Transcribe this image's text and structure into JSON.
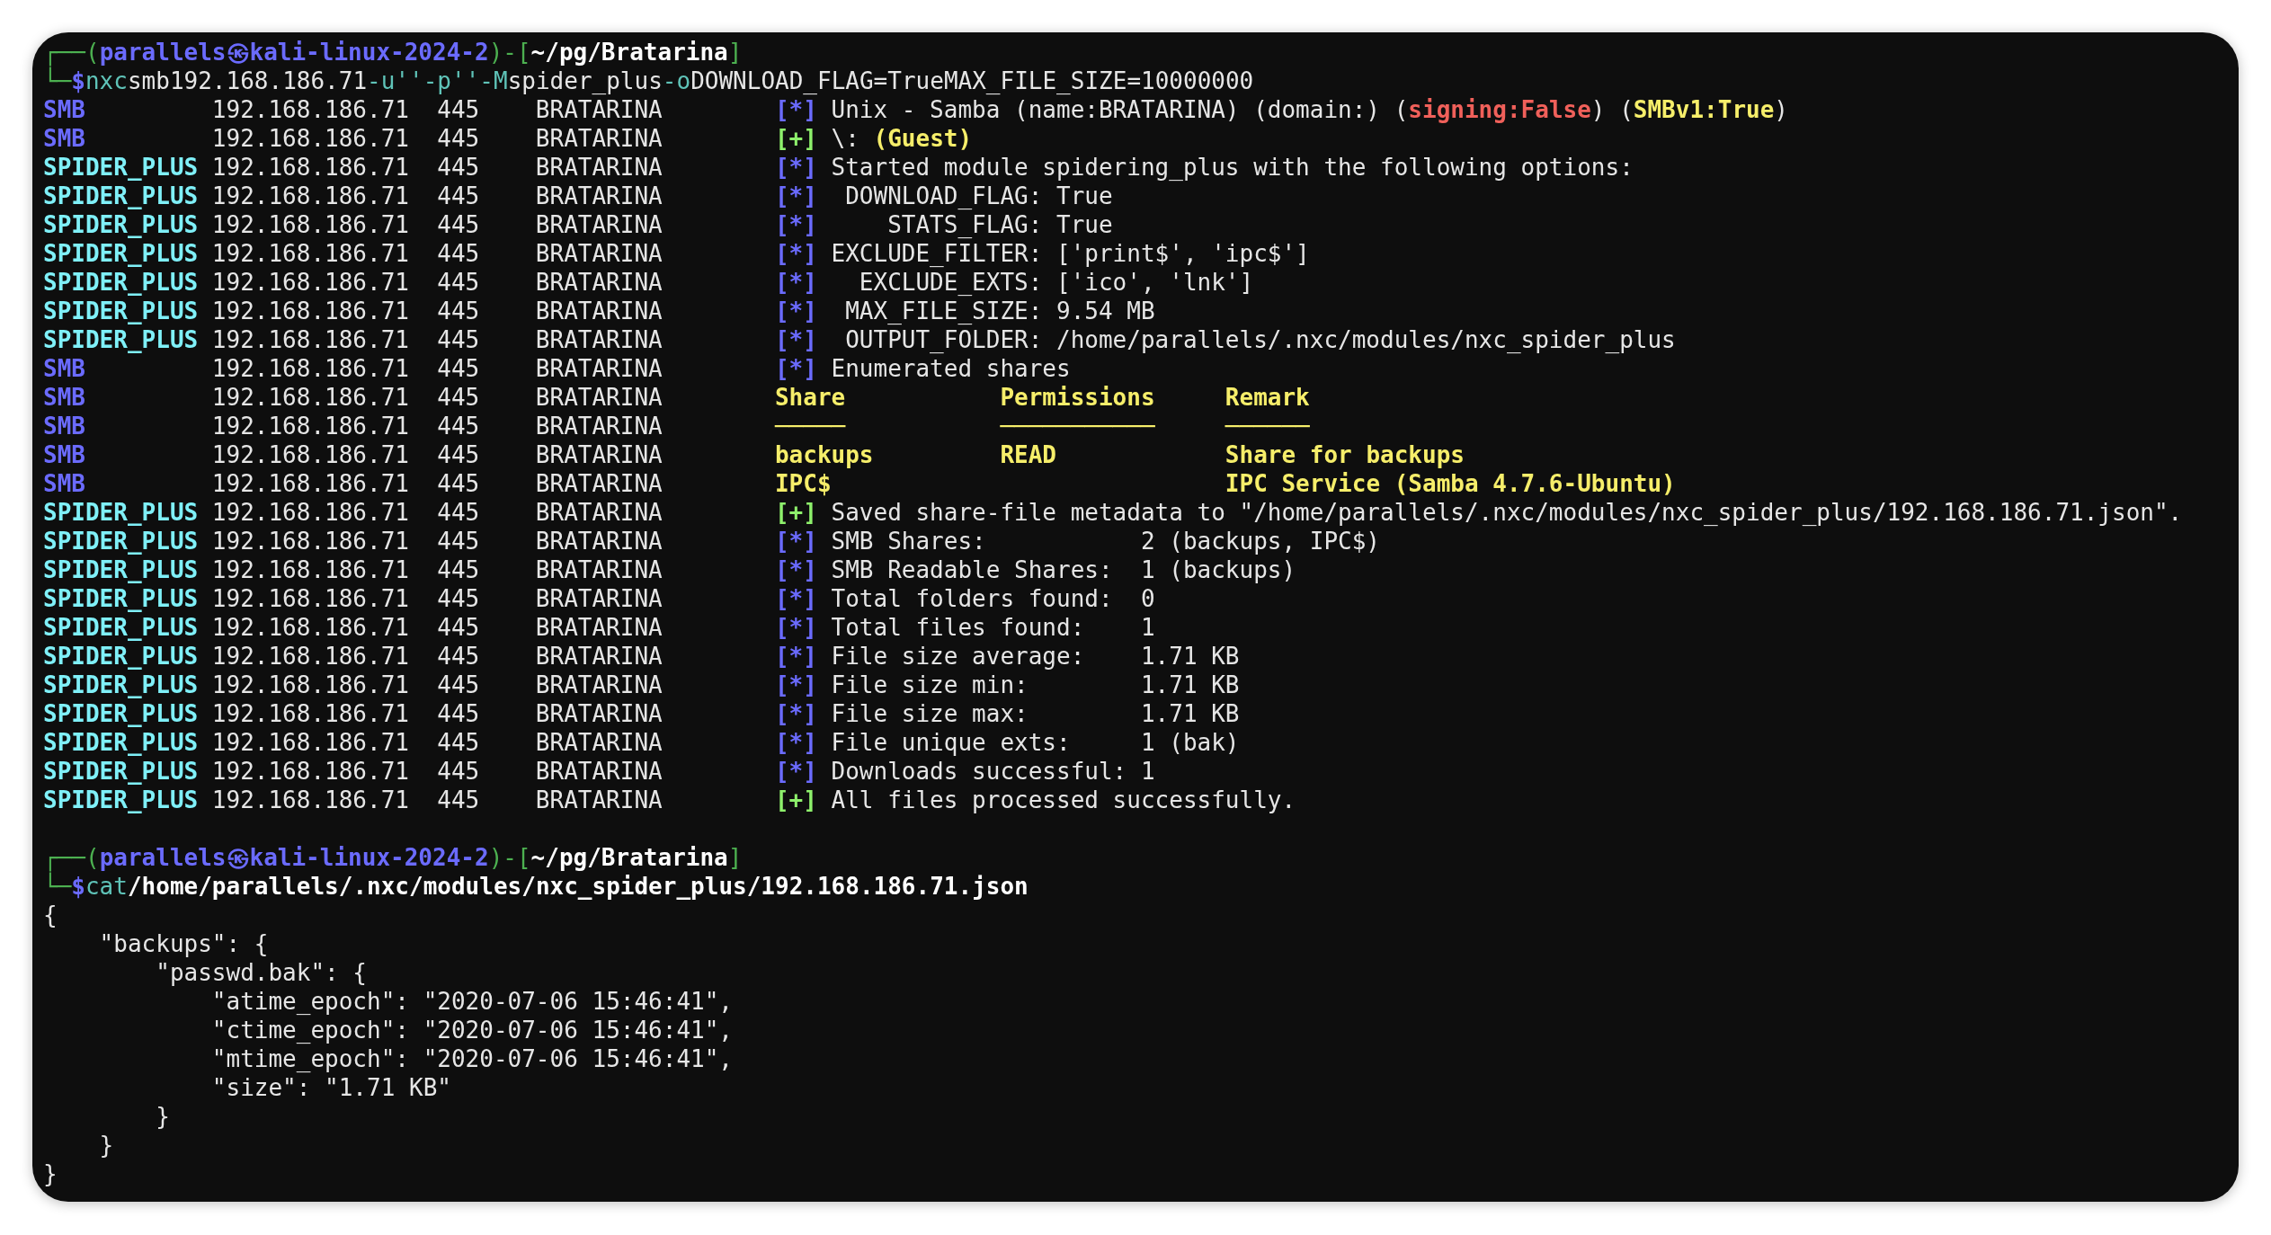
{
  "terminal": {
    "lines": [
      {
        "kind": "prompt",
        "corner": "┌──(",
        "user_host": "parallels㉿kali-linux-2024-2",
        "mid": ")-[",
        "path": "~/pg/Bratarina",
        "end": "]"
      },
      {
        "kind": "command",
        "lead": "└─",
        "symbol": "$",
        "parts": [
          {
            "kind": "program",
            "text": "nxc"
          },
          {
            "kind": "arg",
            "text": "smb"
          },
          {
            "kind": "arg",
            "text": "192.168.186.71"
          },
          {
            "kind": "flag",
            "text": "-u"
          },
          {
            "kind": "flag",
            "text": "''"
          },
          {
            "kind": "flag",
            "text": "-p"
          },
          {
            "kind": "flag",
            "text": "''"
          },
          {
            "kind": "flag",
            "text": "-M"
          },
          {
            "kind": "arg",
            "text": "spider_plus"
          },
          {
            "kind": "flag",
            "text": "-o"
          },
          {
            "kind": "arg",
            "text": "DOWNLOAD_FLAG=True"
          },
          {
            "kind": "arg",
            "text": "MAX_FILE_SIZE=10000000"
          }
        ]
      },
      {
        "kind": "log",
        "module": "SMB",
        "color": "#6b6bff",
        "ip": "192.168.186.71",
        "port": "445",
        "host": "BRATARINA",
        "marker": {
          "text": "[*]",
          "color": "#6b6bff"
        },
        "message": [
          {
            "kind": "plain",
            "text": "Unix - Samba (name:BRATARINA) (domain:) ("
          },
          {
            "kind": "bad",
            "text": "signing:False"
          },
          {
            "kind": "plain",
            "text": ") ("
          },
          {
            "kind": "warn",
            "text": "SMBv1:True"
          },
          {
            "kind": "plain",
            "text": ")"
          }
        ]
      },
      {
        "kind": "log",
        "module": "SMB",
        "color": "#6b6bff",
        "ip": "192.168.186.71",
        "port": "445",
        "host": "BRATARINA",
        "marker": {
          "text": "[+]",
          "color": "#8ef06c"
        },
        "message": [
          {
            "kind": "plain",
            "text": "\\: "
          },
          {
            "kind": "warn",
            "text": "(Guest)"
          }
        ]
      },
      {
        "kind": "log",
        "module": "SPIDER_PLUS",
        "color": "#7ff0f8",
        "ip": "192.168.186.71",
        "port": "445",
        "host": "BRATARINA",
        "marker": {
          "text": "[*]",
          "color": "#6b6bff"
        },
        "message": [
          {
            "kind": "plain",
            "text": "Started module spidering_plus with the following options:"
          }
        ]
      },
      {
        "kind": "log",
        "module": "SPIDER_PLUS",
        "color": "#7ff0f8",
        "ip": "192.168.186.71",
        "port": "445",
        "host": "BRATARINA",
        "marker": {
          "text": "[*]",
          "color": "#6b6bff"
        },
        "message": [
          {
            "kind": "plain",
            "text": " DOWNLOAD_FLAG: True"
          }
        ]
      },
      {
        "kind": "log",
        "module": "SPIDER_PLUS",
        "color": "#7ff0f8",
        "ip": "192.168.186.71",
        "port": "445",
        "host": "BRATARINA",
        "marker": {
          "text": "[*]",
          "color": "#6b6bff"
        },
        "message": [
          {
            "kind": "plain",
            "text": "    STATS_FLAG: True"
          }
        ]
      },
      {
        "kind": "log",
        "module": "SPIDER_PLUS",
        "color": "#7ff0f8",
        "ip": "192.168.186.71",
        "port": "445",
        "host": "BRATARINA",
        "marker": {
          "text": "[*]",
          "color": "#6b6bff"
        },
        "message": [
          {
            "kind": "plain",
            "text": "EXCLUDE_FILTER: ['print$', 'ipc$']"
          }
        ]
      },
      {
        "kind": "log",
        "module": "SPIDER_PLUS",
        "color": "#7ff0f8",
        "ip": "192.168.186.71",
        "port": "445",
        "host": "BRATARINA",
        "marker": {
          "text": "[*]",
          "color": "#6b6bff"
        },
        "message": [
          {
            "kind": "plain",
            "text": "  EXCLUDE_EXTS: ['ico', 'lnk']"
          }
        ]
      },
      {
        "kind": "log",
        "module": "SPIDER_PLUS",
        "color": "#7ff0f8",
        "ip": "192.168.186.71",
        "port": "445",
        "host": "BRATARINA",
        "marker": {
          "text": "[*]",
          "color": "#6b6bff"
        },
        "message": [
          {
            "kind": "plain",
            "text": " MAX_FILE_SIZE: 9.54 MB"
          }
        ]
      },
      {
        "kind": "log",
        "module": "SPIDER_PLUS",
        "color": "#7ff0f8",
        "ip": "192.168.186.71",
        "port": "445",
        "host": "BRATARINA",
        "marker": {
          "text": "[*]",
          "color": "#6b6bff"
        },
        "message": [
          {
            "kind": "plain",
            "text": " OUTPUT_FOLDER: /home/parallels/.nxc/modules/nxc_spider_plus"
          }
        ]
      },
      {
        "kind": "log",
        "module": "SMB",
        "color": "#6b6bff",
        "ip": "192.168.186.71",
        "port": "445",
        "host": "BRATARINA",
        "marker": {
          "text": "[*]",
          "color": "#6b6bff"
        },
        "message": [
          {
            "kind": "plain",
            "text": "Enumerated shares"
          }
        ]
      },
      {
        "kind": "table",
        "module": "SMB",
        "color": "#6b6bff",
        "ip": "192.168.186.71",
        "port": "445",
        "host": "BRATARINA",
        "share": "Share",
        "permissions": "Permissions",
        "remark": "Remark"
      },
      {
        "kind": "table",
        "module": "SMB",
        "color": "#6b6bff",
        "ip": "192.168.186.71",
        "port": "445",
        "host": "BRATARINA",
        "share": "─────",
        "permissions": "───────────",
        "remark": "──────"
      },
      {
        "kind": "table",
        "module": "SMB",
        "color": "#6b6bff",
        "ip": "192.168.186.71",
        "port": "445",
        "host": "BRATARINA",
        "share": "backups",
        "permissions": "READ",
        "remark": "Share for backups"
      },
      {
        "kind": "table",
        "module": "SMB",
        "color": "#6b6bff",
        "ip": "192.168.186.71",
        "port": "445",
        "host": "BRATARINA",
        "share": "IPC$",
        "remark": "IPC Service (Samba 4.7.6-Ubuntu)"
      },
      {
        "kind": "log",
        "module": "SPIDER_PLUS",
        "color": "#7ff0f8",
        "ip": "192.168.186.71",
        "port": "445",
        "host": "BRATARINA",
        "marker": {
          "text": "[+]",
          "color": "#8ef06c"
        },
        "message": [
          {
            "kind": "plain",
            "text": "Saved share-file metadata to \"/home/parallels/.nxc/modules/nxc_spider_plus/192.168.186.71.json\"."
          }
        ]
      },
      {
        "kind": "log",
        "module": "SPIDER_PLUS",
        "color": "#7ff0f8",
        "ip": "192.168.186.71",
        "port": "445",
        "host": "BRATARINA",
        "marker": {
          "text": "[*]",
          "color": "#6b6bff"
        },
        "message": [
          {
            "kind": "plain",
            "text": "SMB Shares:           2 (backups, IPC$)"
          }
        ]
      },
      {
        "kind": "log",
        "module": "SPIDER_PLUS",
        "color": "#7ff0f8",
        "ip": "192.168.186.71",
        "port": "445",
        "host": "BRATARINA",
        "marker": {
          "text": "[*]",
          "color": "#6b6bff"
        },
        "message": [
          {
            "kind": "plain",
            "text": "SMB Readable Shares:  1 (backups)"
          }
        ]
      },
      {
        "kind": "log",
        "module": "SPIDER_PLUS",
        "color": "#7ff0f8",
        "ip": "192.168.186.71",
        "port": "445",
        "host": "BRATARINA",
        "marker": {
          "text": "[*]",
          "color": "#6b6bff"
        },
        "message": [
          {
            "kind": "plain",
            "text": "Total folders found:  0"
          }
        ]
      },
      {
        "kind": "log",
        "module": "SPIDER_PLUS",
        "color": "#7ff0f8",
        "ip": "192.168.186.71",
        "port": "445",
        "host": "BRATARINA",
        "marker": {
          "text": "[*]",
          "color": "#6b6bff"
        },
        "message": [
          {
            "kind": "plain",
            "text": "Total files found:    1"
          }
        ]
      },
      {
        "kind": "log",
        "module": "SPIDER_PLUS",
        "color": "#7ff0f8",
        "ip": "192.168.186.71",
        "port": "445",
        "host": "BRATARINA",
        "marker": {
          "text": "[*]",
          "color": "#6b6bff"
        },
        "message": [
          {
            "kind": "plain",
            "text": "File size average:    1.71 KB"
          }
        ]
      },
      {
        "kind": "log",
        "module": "SPIDER_PLUS",
        "color": "#7ff0f8",
        "ip": "192.168.186.71",
        "port": "445",
        "host": "BRATARINA",
        "marker": {
          "text": "[*]",
          "color": "#6b6bff"
        },
        "message": [
          {
            "kind": "plain",
            "text": "File size min:        1.71 KB"
          }
        ]
      },
      {
        "kind": "log",
        "module": "SPIDER_PLUS",
        "color": "#7ff0f8",
        "ip": "192.168.186.71",
        "port": "445",
        "host": "BRATARINA",
        "marker": {
          "text": "[*]",
          "color": "#6b6bff"
        },
        "message": [
          {
            "kind": "plain",
            "text": "File size max:        1.71 KB"
          }
        ]
      },
      {
        "kind": "log",
        "module": "SPIDER_PLUS",
        "color": "#7ff0f8",
        "ip": "192.168.186.71",
        "port": "445",
        "host": "BRATARINA",
        "marker": {
          "text": "[*]",
          "color": "#6b6bff"
        },
        "message": [
          {
            "kind": "plain",
            "text": "File unique exts:     1 (bak)"
          }
        ]
      },
      {
        "kind": "log",
        "module": "SPIDER_PLUS",
        "color": "#7ff0f8",
        "ip": "192.168.186.71",
        "port": "445",
        "host": "BRATARINA",
        "marker": {
          "text": "[*]",
          "color": "#6b6bff"
        },
        "message": [
          {
            "kind": "plain",
            "text": "Downloads successful: 1"
          }
        ]
      },
      {
        "kind": "log",
        "module": "SPIDER_PLUS",
        "color": "#7ff0f8",
        "ip": "192.168.186.71",
        "port": "445",
        "host": "BRATARINA",
        "marker": {
          "text": "[+]",
          "color": "#8ef06c"
        },
        "message": [
          {
            "kind": "plain",
            "text": "All files processed successfully."
          }
        ]
      },
      {
        "kind": "blank"
      },
      {
        "kind": "prompt",
        "corner": "┌──(",
        "user_host": "parallels㉿kali-linux-2024-2",
        "mid": ")-[",
        "path": "~/pg/Bratarina",
        "end": "]"
      },
      {
        "kind": "command",
        "lead": "└─",
        "symbol": "$",
        "parts": [
          {
            "kind": "program",
            "text": "cat"
          },
          {
            "kind": "path",
            "text": "/home/parallels/.nxc/modules/nxc_spider_plus/192.168.186.71.json"
          }
        ]
      },
      {
        "kind": "output",
        "text": "{"
      },
      {
        "kind": "output",
        "text": "    \"backups\": {"
      },
      {
        "kind": "output",
        "text": "        \"passwd.bak\": {"
      },
      {
        "kind": "output",
        "text": "            \"atime_epoch\": \"2020-07-06 15:46:41\","
      },
      {
        "kind": "output",
        "text": "            \"ctime_epoch\": \"2020-07-06 15:46:41\","
      },
      {
        "kind": "output",
        "text": "            \"mtime_epoch\": \"2020-07-06 15:46:41\","
      },
      {
        "kind": "output",
        "text": "            \"size\": \"1.71 KB\""
      },
      {
        "kind": "output",
        "text": "        }"
      },
      {
        "kind": "output",
        "text": "    }"
      },
      {
        "kind": "output",
        "text": "}"
      }
    ]
  }
}
